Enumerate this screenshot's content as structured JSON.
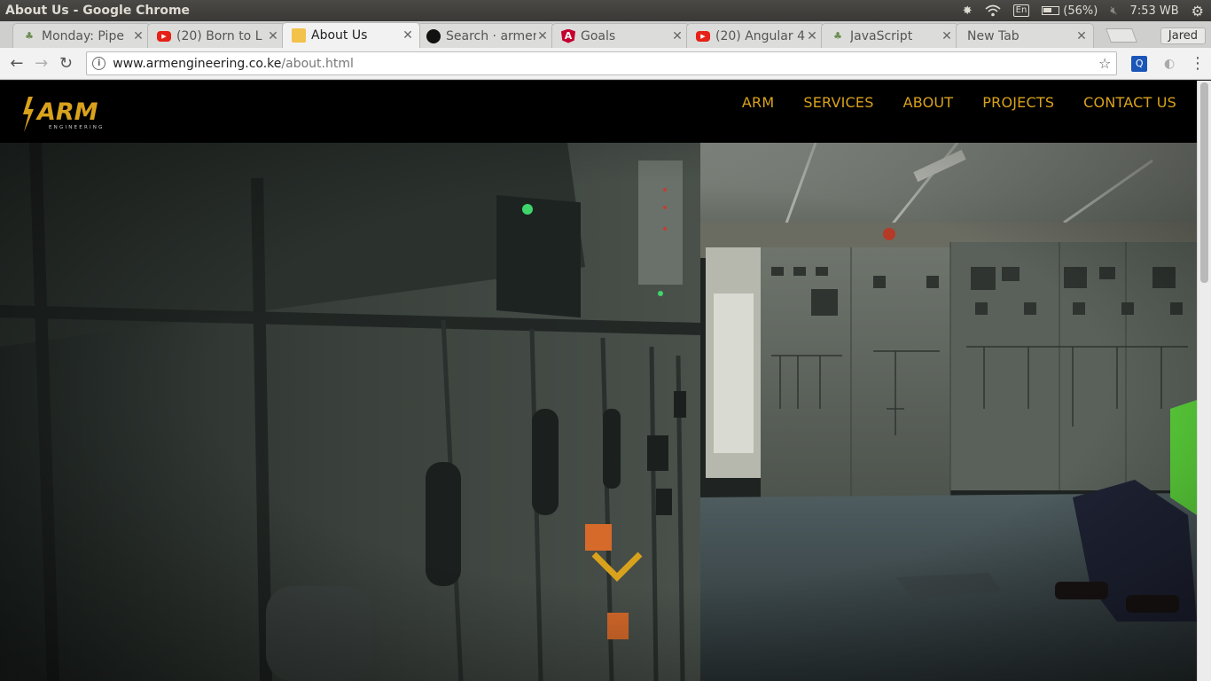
{
  "os": {
    "window_title": "About Us - Google Chrome",
    "keyboard_layout": "En",
    "battery": "(56%)",
    "clock": "7:53 WB"
  },
  "browser": {
    "tabs": [
      {
        "label": "Monday: Pipe",
        "favicon": "tree-icon"
      },
      {
        "label": "(20) Born to L",
        "favicon": "youtube-icon"
      },
      {
        "label": "About Us",
        "favicon": "arm-icon",
        "active": true
      },
      {
        "label": "Search · armen",
        "favicon": "github-icon"
      },
      {
        "label": "Goals",
        "favicon": "angular-icon"
      },
      {
        "label": "(20) Angular 4",
        "favicon": "youtube-icon"
      },
      {
        "label": "JavaScript",
        "favicon": "tree-icon"
      },
      {
        "label": "New Tab",
        "favicon": "none"
      }
    ],
    "profile_name": "Jared",
    "url_host": "www.armengineering.co.ke",
    "url_path": "/about.html"
  },
  "site": {
    "logo_text": "ARM",
    "logo_subtext": "ENGINEERING",
    "nav": [
      "ARM",
      "SERVICES",
      "ABOUT",
      "PROJECTS",
      "CONTACT US"
    ],
    "accent_color": "#d9a21c"
  }
}
